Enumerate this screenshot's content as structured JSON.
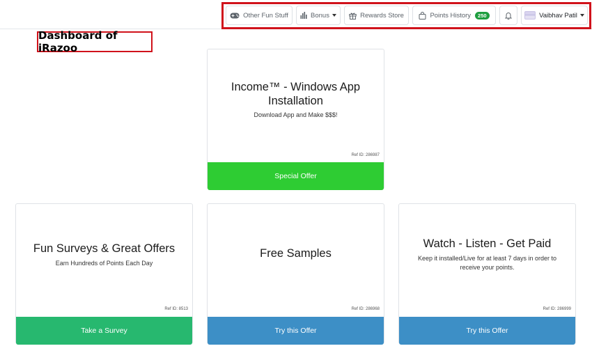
{
  "nav": {
    "fun_stuff_label": "Other Fun Stuff",
    "bonus_label": "Bonus",
    "rewards_label": "Rewards Store",
    "points_history_label": "Points History",
    "points_badge": "250",
    "user_name": "Vaibhav Patil"
  },
  "annotation": {
    "label": "Dashboard of iRazoo"
  },
  "offers": {
    "featured": {
      "title_line1": "Income™ - Windows App",
      "title_line2": "Installation",
      "subtitle": "Download App and Make $$$!",
      "ref": "Ref ID: 286987",
      "button": "Special Offer"
    },
    "surveys": {
      "title": "Fun Surveys & Great Offers",
      "subtitle": "Earn Hundreds of Points Each Day",
      "ref": "Ref ID: 8513",
      "button": "Take a Survey"
    },
    "samples": {
      "title": "Free Samples",
      "ref": "Ref ID: 286968",
      "button": "Try this Offer"
    },
    "watch": {
      "title": "Watch - Listen - Get Paid",
      "subtitle_line1": "Keep it installed/Live for at least 7 days in order to",
      "subtitle_line2": "receive your points.",
      "ref": "Ref ID: 286999",
      "button": "Try this Offer"
    }
  },
  "colors": {
    "special_offer": "#2ecc33",
    "take_survey": "#27b86f",
    "try_offer": "#3d8fc6",
    "highlight_border": "#d0121b",
    "badge": "#1e9e3f"
  },
  "icons": {
    "fun_stuff": "gamepad-icon",
    "bonus": "bar-chart-icon",
    "rewards": "gift-icon",
    "points_history": "shopping-bag-icon",
    "notifications": "bell-icon",
    "user": "avatar"
  }
}
